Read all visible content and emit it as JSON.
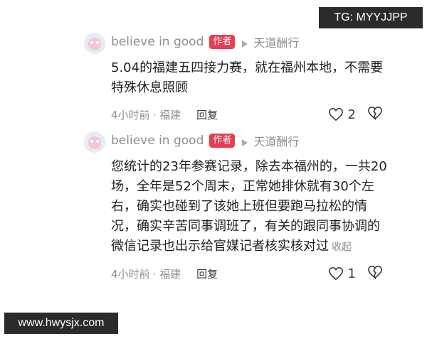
{
  "watermarks": {
    "top": "TG: MYYJJPP",
    "bottom": "www.hwysjx.com"
  },
  "comments": [
    {
      "username": "believe in good",
      "badge": "作者",
      "reply_to": "天道酬行",
      "content": "5.04的福建五四接力赛，就在福州本地，不需要特殊休息照顾",
      "time": "4小时前",
      "location": "· 福建",
      "reply_label": "回复",
      "likes": "2"
    },
    {
      "username": "believe in good",
      "badge": "作者",
      "reply_to": "天道酬行",
      "content": "您统计的23年参赛记录，除去本福州的，一共20场，全年是52个周末，正常她排休就有30个左右，确实也碰到了该她上班但要跑马拉松的情况，确实辛苦同事调班了，有关的跟同事协调的微信记录也出示给官媒记者核实核对过",
      "collapse_label": "收起",
      "time": "4小时前",
      "location": "· 福建",
      "reply_label": "回复",
      "likes": "1"
    }
  ],
  "icons": {
    "avatar": "avatar-image",
    "arrow": "reply-arrow-icon",
    "like": "heart-icon",
    "dislike": "broken-heart-icon"
  },
  "colors": {
    "badge": "#ea3b52",
    "muted_text": "#8e8e8e",
    "watermark_bg": "#2b2b2b"
  }
}
